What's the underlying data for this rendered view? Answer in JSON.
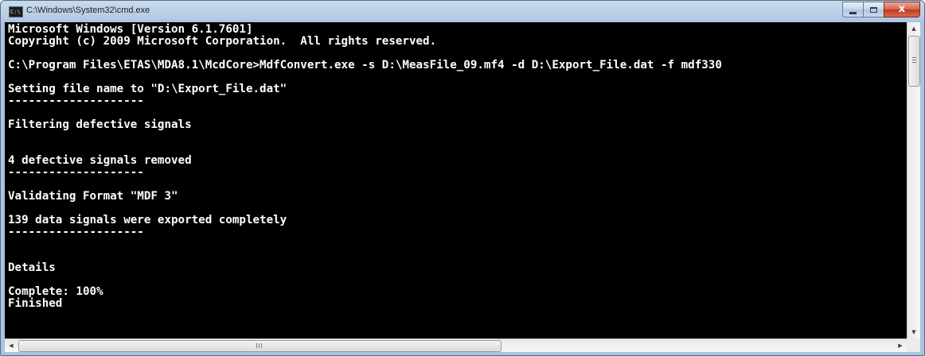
{
  "window": {
    "title": "C:\\Windows\\System32\\cmd.exe",
    "app_icon": "command-prompt-icon",
    "app_icon_text": "C:\\",
    "controls": {
      "minimize_icon": "minimize-icon",
      "maximize_icon": "maximize-icon",
      "close_icon": "close-icon",
      "close_glyph": "x"
    },
    "colors": {
      "console_background": "#000000",
      "console_text": "#ffffff",
      "close_button": "#c4391f",
      "frame": "#a9c3e0"
    }
  },
  "console": {
    "lines": [
      "Microsoft Windows [Version 6.1.7601]",
      "Copyright (c) 2009 Microsoft Corporation.  All rights reserved.",
      "",
      "C:\\Program Files\\ETAS\\MDA8.1\\McdCore>MdfConvert.exe -s D:\\MeasFile_09.mf4 -d D:\\Export_File.dat -f mdf330",
      "",
      "Setting file name to \"D:\\Export_File.dat\"",
      "--------------------",
      "",
      "Filtering defective signals",
      "",
      "",
      "4 defective signals removed",
      "--------------------",
      "",
      "Validating Format \"MDF 3\"",
      "",
      "139 data signals were exported completely",
      "--------------------",
      "",
      "",
      "Details",
      "",
      "Complete: 100%",
      "Finished"
    ]
  },
  "scrollbars": {
    "up_arrow": "▲",
    "down_arrow": "▼",
    "left_arrow": "◀",
    "right_arrow": "▶"
  }
}
